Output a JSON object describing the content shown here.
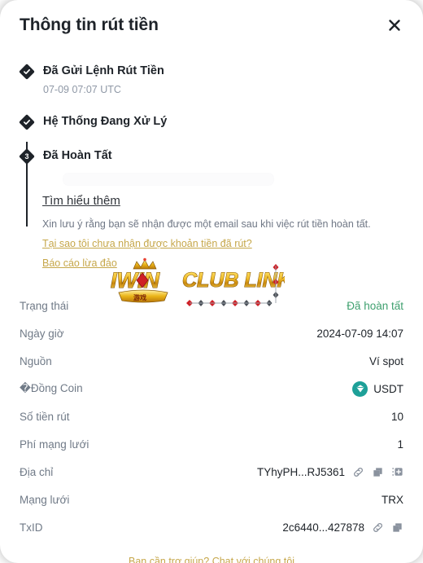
{
  "header": {
    "title": "Thông tin rút tiền",
    "close_icon": "close-icon"
  },
  "timeline": {
    "steps": [
      {
        "marker": "check",
        "label": "Đã Gửi Lệnh Rút Tiền",
        "time": "07-09 07:07 UTC"
      },
      {
        "marker": "check",
        "label": "Hệ Thống Đang Xử Lý",
        "time": ""
      },
      {
        "marker": "3",
        "label": "Đã Hoàn Tất",
        "time": ""
      }
    ]
  },
  "notes": {
    "learn_more": "Tìm hiểu thêm",
    "info_text": "Xin lưu ý rằng bạn sẽ nhận được một email sau khi việc rút tiền hoàn tất.",
    "link_not_received": "Tại sao tôi chưa nhận được khoản tiền đã rút?",
    "link_report_fraud": "Báo cáo lừa đảo"
  },
  "watermark": {
    "text_1": "IWIN",
    "text_2": "CLUB LINK"
  },
  "details": {
    "rows": [
      {
        "label": "Trạng thái",
        "value": "Đã hoàn tất",
        "style": "green"
      },
      {
        "label": "Ngày giờ",
        "value": "2024-07-09 14:07",
        "style": "plain"
      },
      {
        "label": "Nguồn",
        "value": "Ví spot",
        "style": "plain"
      },
      {
        "label": "�Đồng Coin",
        "value": "USDT",
        "style": "coin"
      },
      {
        "label": "Số tiền rút",
        "value": "10",
        "style": "plain"
      },
      {
        "label": "Phí mạng lưới",
        "value": "1",
        "style": "plain"
      },
      {
        "label": "Địa chỉ",
        "value": "TYhyPH...RJ5361",
        "style": "addr"
      },
      {
        "label": "Mạng lưới",
        "value": "TRX",
        "style": "plain"
      },
      {
        "label": "TxID",
        "value": "2c6440...427878",
        "style": "txid"
      }
    ]
  },
  "footer": {
    "support_link": "Bạn cần trợ giúp? Chat với chúng tôi"
  },
  "colors": {
    "text_primary": "#1e2329",
    "text_muted": "#707a87",
    "status_green": "#3fa06f",
    "link_gold": "#c6a74a",
    "usdt_teal": "#1da098"
  }
}
